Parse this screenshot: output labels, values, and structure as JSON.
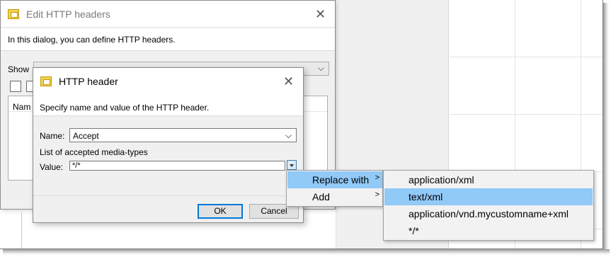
{
  "edit_dialog": {
    "title": "Edit HTTP headers",
    "description": "In this dialog, you can define HTTP headers.",
    "show_label": "Show",
    "list_header": "Nam"
  },
  "header_dialog": {
    "title": "HTTP header",
    "description": "Specify name and value of the HTTP header.",
    "name_label": "Name:",
    "name_value": "Accept",
    "list_label": "List of accepted media-types",
    "value_label": "Value:",
    "value_value": "*/*",
    "ok_label": "OK",
    "cancel_label": "Cancel"
  },
  "context_menu": {
    "items": [
      {
        "label": "Replace with",
        "highlighted": true
      },
      {
        "label": "Add",
        "highlighted": false
      }
    ],
    "submenu": [
      {
        "label": "application/xml",
        "highlighted": false
      },
      {
        "label": "text/xml",
        "highlighted": true
      },
      {
        "label": "application/vnd.mycustomname+xml",
        "highlighted": false
      },
      {
        "label": "*/*",
        "highlighted": false
      }
    ]
  },
  "colors": {
    "highlight": "#91c9f7",
    "focus": "#0078d7"
  }
}
